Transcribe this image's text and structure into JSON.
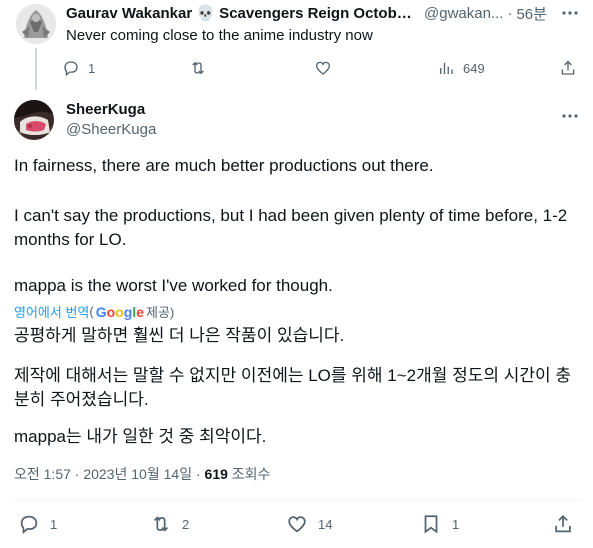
{
  "reply": {
    "author_name": "Gaurav Wakankar 💀 Scavengers Reign Octobe...",
    "author_handle": "@gwakan...",
    "separator": "·",
    "time": "56분",
    "text": "Never coming close to the anime industry now",
    "actions": {
      "replies": "1",
      "views": "649"
    }
  },
  "tweet": {
    "author_name": "SheerKuga",
    "author_handle": "@SheerKuga",
    "paragraphs": [
      "In fairness, there are much better productions out there.",
      "I can't say the productions, but I had been given plenty of time before, 1-2 months for LO.",
      "mappa is the worst I've worked for though."
    ],
    "translation": {
      "link_text": "영어에서 번역",
      "open_paren": "(",
      "google_letters": [
        "G",
        "o",
        "o",
        "g",
        "l",
        "e"
      ],
      "suffix": " 제공)"
    },
    "translated_paragraphs": [
      "공평하게 말하면 훨씬 더 나은 작품이 있습니다.",
      "제작에 대해서는 말할 수 없지만 이전에는 LO를 위해 1~2개월 정도의 시간이 충분히 주어졌습니다.",
      "mappa는 내가 일한 것 중 최악이다."
    ],
    "meta": {
      "time": "오전 1:57",
      "sep": " · ",
      "date": "2023년 10월 14일",
      "sep2": " · ",
      "views_count": "619",
      "views_label": " 조회수"
    },
    "actions": {
      "replies": "1",
      "retweets": "2",
      "likes": "14",
      "bookmarks": "1"
    }
  },
  "colors": {
    "text_primary": "#0f1419",
    "text_secondary": "#536471",
    "link": "#1d9bf0",
    "divider": "#eff3f4",
    "google_blue": "#4285f4",
    "google_red": "#ea4335",
    "google_yellow": "#fbbc05",
    "google_green": "#34a853"
  },
  "icons": [
    "more-icon",
    "reply-icon",
    "retweet-icon",
    "like-icon",
    "views-icon",
    "share-icon",
    "bookmark-icon"
  ]
}
